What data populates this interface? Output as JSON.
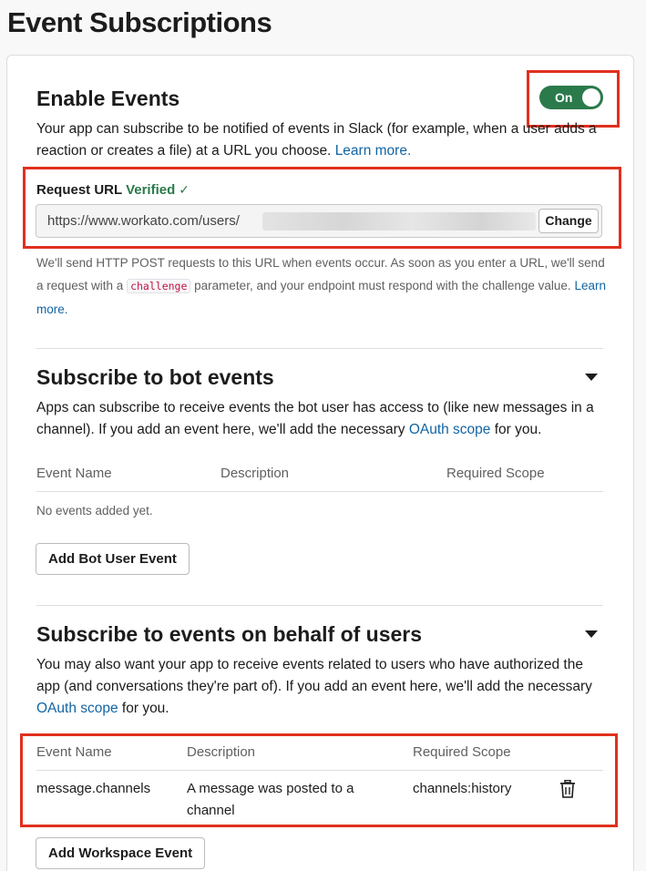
{
  "page": {
    "title": "Event Subscriptions"
  },
  "enable_events": {
    "heading": "Enable Events",
    "toggle_label": "On",
    "description": "Your app can subscribe to be notified of events in Slack (for example, when a user adds a reaction or creates a file) at a URL you choose.",
    "learn_more": "Learn more.",
    "request_url": {
      "label": "Request URL",
      "status": "Verified",
      "check": "✓",
      "value": "https://www.workato.com/users/",
      "change_label": "Change"
    },
    "note_part1": "We'll send HTTP POST requests to this URL when events occur. As soon as you enter a URL, we'll send a request with a",
    "note_code": "challenge",
    "note_part2": "parameter, and your endpoint must respond with the challenge value.",
    "note_learn_more": "Learn more."
  },
  "bot_events": {
    "heading": "Subscribe to bot events",
    "description_part1": "Apps can subscribe to receive events the bot user has access to (like new messages in a channel). If you add an event here, we'll add the necessary",
    "oauth_link": "OAuth scope",
    "description_part2": "for you.",
    "columns": [
      "Event Name",
      "Description",
      "Required Scope"
    ],
    "empty_text": "No events added yet.",
    "add_button": "Add Bot User Event"
  },
  "user_events": {
    "heading": "Subscribe to events on behalf of users",
    "description_part1": "You may also want your app to receive events related to users who have authorized the app (and conversations they're part of). If you add an event here, we'll add the necessary",
    "oauth_link": "OAuth scope",
    "description_part2": "for you.",
    "columns": [
      "Event Name",
      "Description",
      "Required Scope"
    ],
    "rows": [
      {
        "event_name": "message.channels",
        "description": "A message was posted to a channel",
        "scope": "channels:history",
        "delete_icon": "trash-icon"
      }
    ],
    "add_button": "Add Workspace Event"
  },
  "colors": {
    "accent_green": "#2b7a4b",
    "link_blue": "#1264a3",
    "highlight_red": "#e0301e",
    "code_red": "#c01343"
  }
}
